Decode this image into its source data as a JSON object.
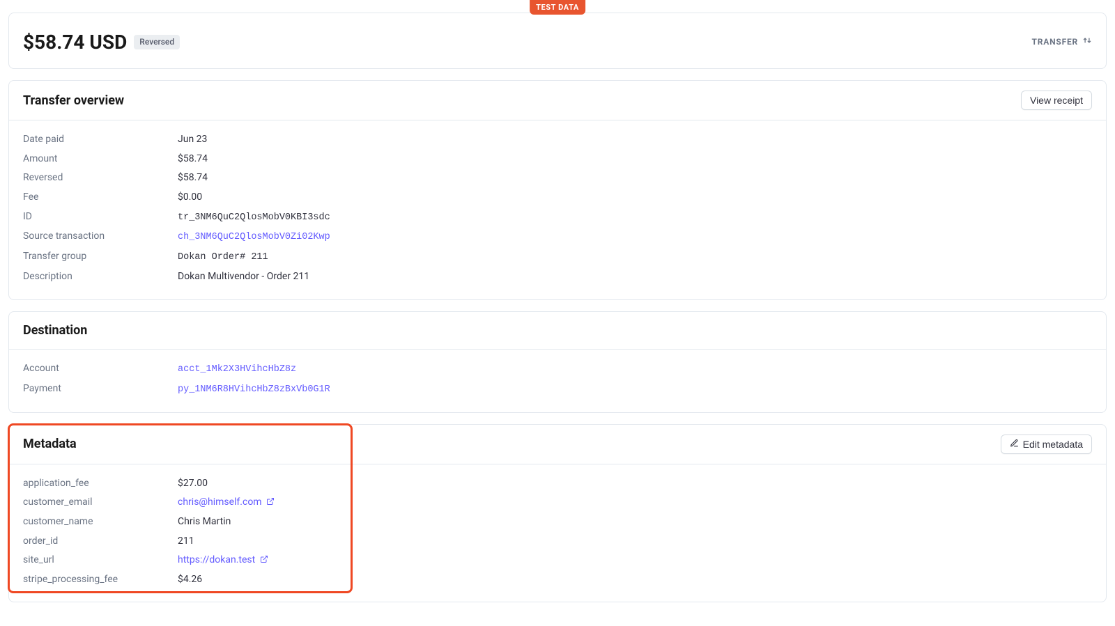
{
  "banner": {
    "test_data": "TEST DATA"
  },
  "header": {
    "amount": "$58.74 USD",
    "status": "Reversed",
    "right_label": "TRANSFER"
  },
  "overview": {
    "title": "Transfer overview",
    "button": "View receipt",
    "rows": {
      "date_paid_label": "Date paid",
      "date_paid": "Jun 23",
      "amount_label": "Amount",
      "amount": "$58.74",
      "reversed_label": "Reversed",
      "reversed": "$58.74",
      "fee_label": "Fee",
      "fee": "$0.00",
      "id_label": "ID",
      "id": "tr_3NM6QuC2QlosMobV0KBI3sdc",
      "source_tx_label": "Source transaction",
      "source_tx": "ch_3NM6QuC2QlosMobV0Zi02Kwp",
      "transfer_group_label": "Transfer group",
      "transfer_group": "Dokan Order# 211",
      "description_label": "Description",
      "description": "Dokan Multivendor - Order 211"
    }
  },
  "destination": {
    "title": "Destination",
    "rows": {
      "account_label": "Account",
      "account": "acct_1Mk2X3HVihcHbZ8z",
      "payment_label": "Payment",
      "payment": "py_1NM6R8HVihcHbZ8zBxVb0G1R"
    }
  },
  "metadata": {
    "title": "Metadata",
    "button": "Edit metadata",
    "rows": {
      "application_fee_label": "application_fee",
      "application_fee": "$27.00",
      "customer_email_label": "customer_email",
      "customer_email": "chris@himself.com",
      "customer_name_label": "customer_name",
      "customer_name": "Chris Martin",
      "order_id_label": "order_id",
      "order_id": "211",
      "site_url_label": "site_url",
      "site_url": "https://dokan.test",
      "stripe_processing_fee_label": "stripe_processing_fee",
      "stripe_processing_fee": "$4.26"
    }
  }
}
